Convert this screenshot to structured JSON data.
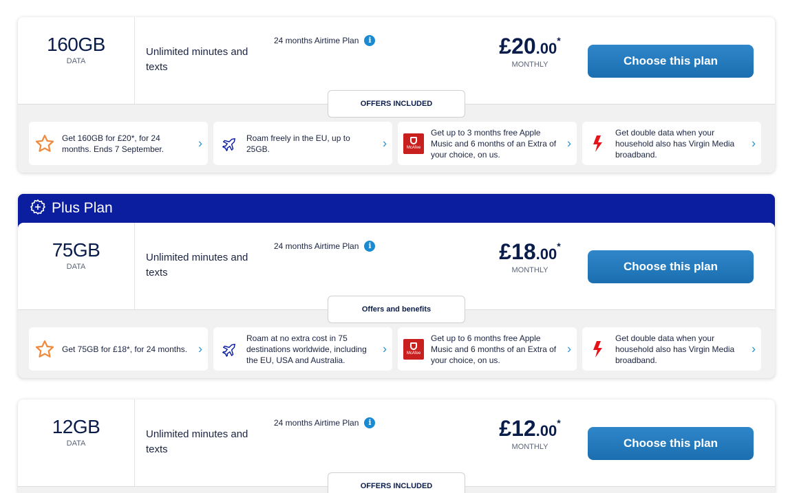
{
  "plans": [
    {
      "data_amount": "160GB",
      "data_label": "DATA",
      "minutes": "Unlimited minutes and texts",
      "airtime": "24 months Airtime Plan",
      "price_pounds": "£20",
      "price_pence": ".00",
      "price_star": "*",
      "price_label": "MONTHLY",
      "cta": "Choose this plan",
      "offers_tab": "OFFERS INCLUDED",
      "offers": [
        {
          "icon": "star-icon",
          "text": "Get 160GB for £20*, for 24 months. Ends 7 September."
        },
        {
          "icon": "plane-icon",
          "text": "Roam freely in the EU, up to 25GB."
        },
        {
          "icon": "mcafee-logo",
          "text": "Get up to 3 months free Apple Music and 6 months of an Extra of your choice, on us."
        },
        {
          "icon": "lightning-icon",
          "text": "Get double data when your household also has Virgin Media broadband."
        }
      ]
    },
    {
      "featured_title": "Plus Plan",
      "data_amount": "75GB",
      "data_label": "DATA",
      "minutes": "Unlimited minutes and texts",
      "airtime": "24 months Airtime Plan",
      "price_pounds": "£18",
      "price_pence": ".00",
      "price_star": "*",
      "price_label": "MONTHLY",
      "cta": "Choose this plan",
      "offers_tab": "Offers and benefits",
      "offers": [
        {
          "icon": "star-icon",
          "text": "Get 75GB for £18*, for 24 months."
        },
        {
          "icon": "plane-icon",
          "text": "Roam at no extra cost in 75 destinations worldwide, including the EU, USA and Australia."
        },
        {
          "icon": "mcafee-logo",
          "text": "Get up to 6 months free Apple Music and 6 months of an Extra of your choice, on us."
        },
        {
          "icon": "lightning-icon",
          "text": "Get double data when your household also has Virgin Media broadband."
        }
      ]
    },
    {
      "data_amount": "12GB",
      "data_label": "DATA",
      "minutes": "Unlimited minutes and texts",
      "airtime": "24 months Airtime Plan",
      "price_pounds": "£12",
      "price_pence": ".00",
      "price_star": "*",
      "price_label": "MONTHLY",
      "cta": "Choose this plan",
      "offers_tab": "OFFERS INCLUDED"
    }
  ],
  "mcafee_label": "McAfee",
  "info_glyph": "i",
  "chevron_glyph": "›",
  "colors": {
    "accent_blue": "#1b6fb1",
    "featured_bar": "#0c1ea0",
    "star": "#f08a3c",
    "lightning": "#e4141b",
    "mcafee": "#c8201f"
  }
}
